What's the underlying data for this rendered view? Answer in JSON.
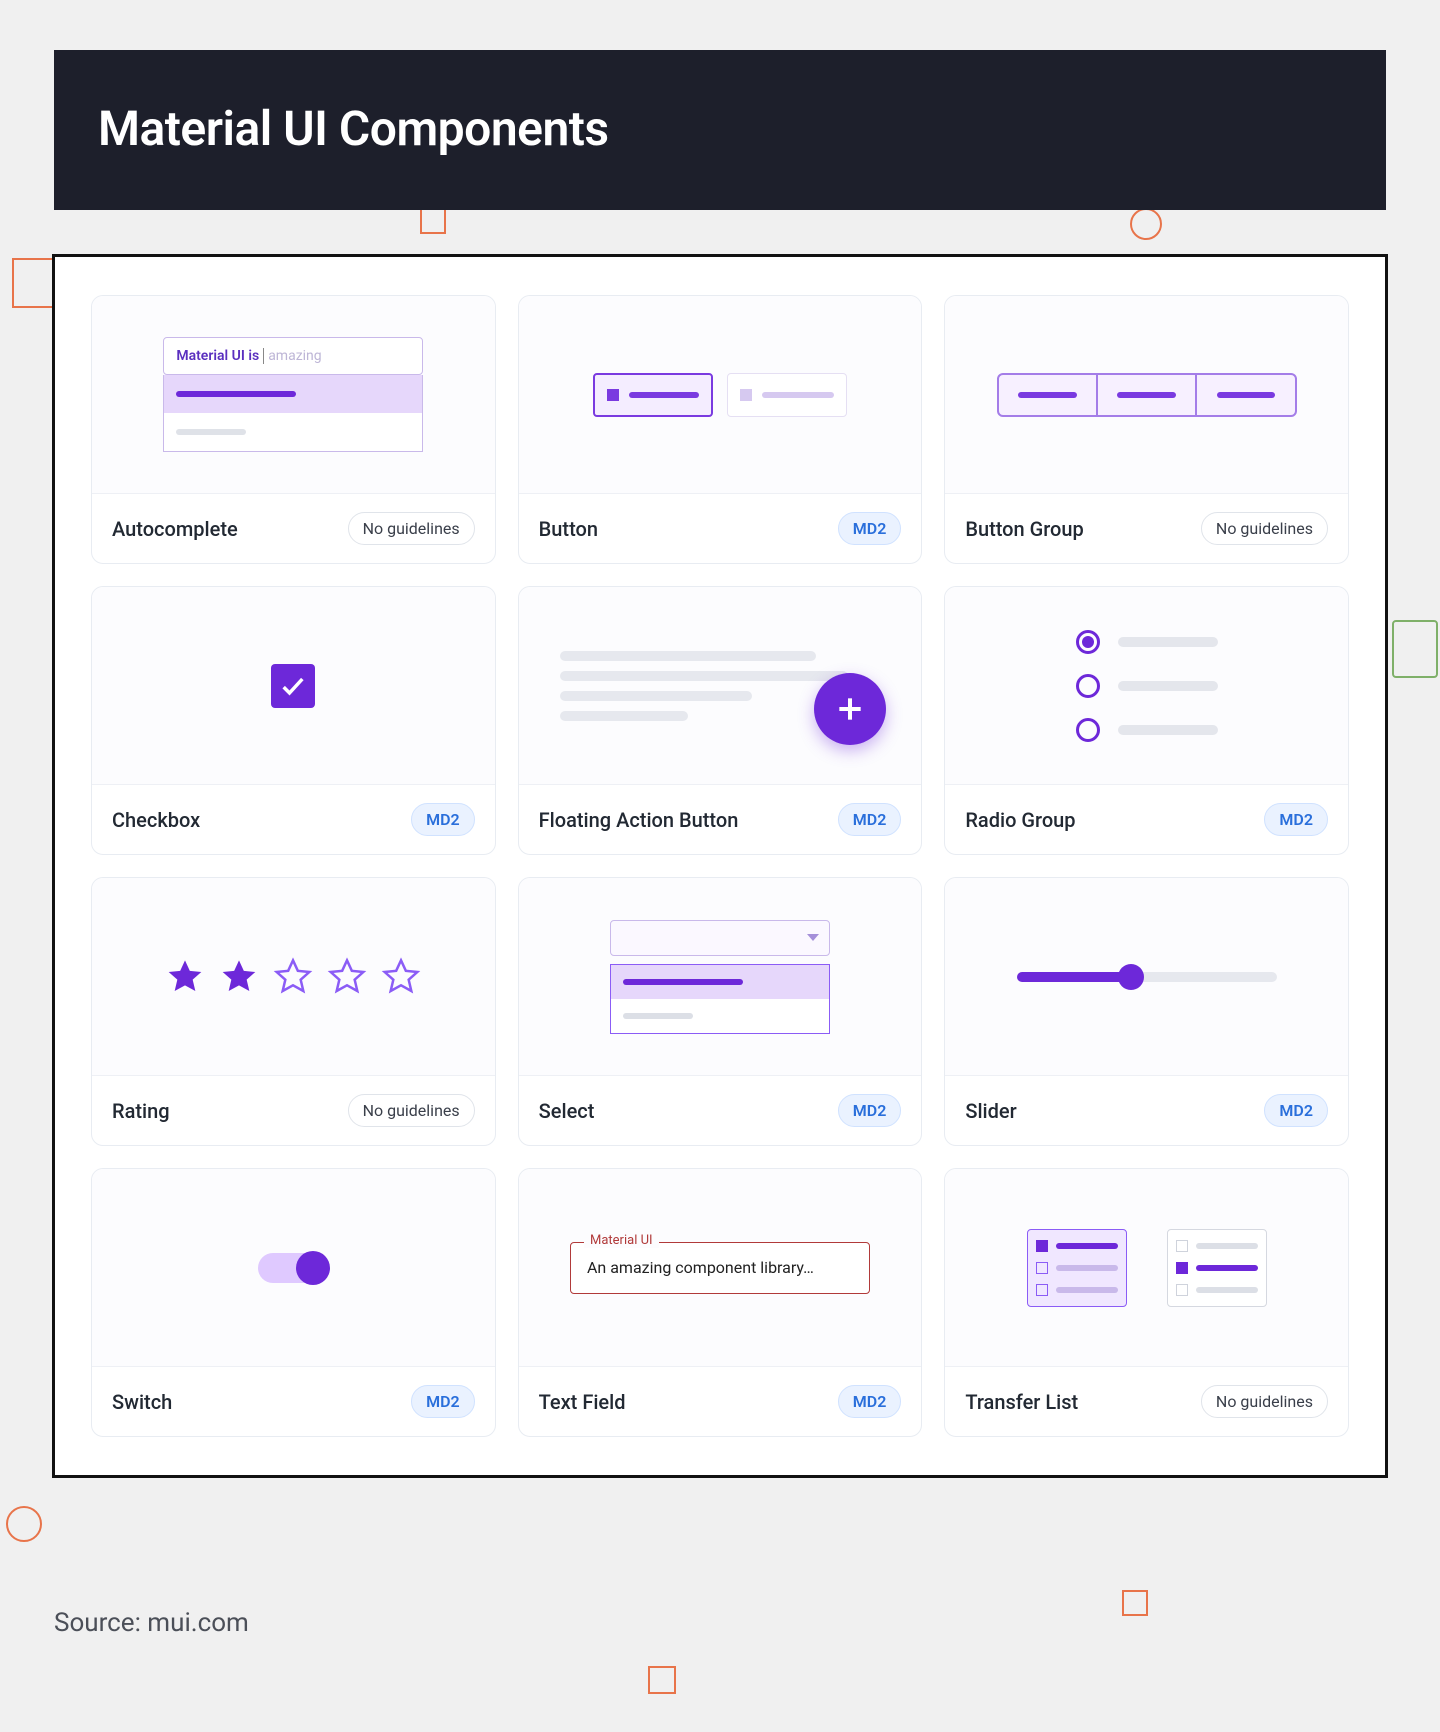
{
  "header": {
    "title": "Material UI Components"
  },
  "badges": {
    "md2": "MD2",
    "no_guidelines": "No guidelines"
  },
  "cards": {
    "autocomplete": {
      "title": "Autocomplete",
      "badge_key": "no_guidelines",
      "input_text": "Material UI is",
      "suggest_text": "amazing"
    },
    "button": {
      "title": "Button",
      "badge_key": "md2"
    },
    "button_group": {
      "title": "Button Group",
      "badge_key": "no_guidelines"
    },
    "checkbox": {
      "title": "Checkbox",
      "badge_key": "md2"
    },
    "fab": {
      "title": "Floating Action Button",
      "badge_key": "md2"
    },
    "radio": {
      "title": "Radio Group",
      "badge_key": "md2"
    },
    "rating": {
      "title": "Rating",
      "badge_key": "no_guidelines",
      "value": 2,
      "max": 5
    },
    "select": {
      "title": "Select",
      "badge_key": "md2"
    },
    "slider": {
      "title": "Slider",
      "badge_key": "md2"
    },
    "switch": {
      "title": "Switch",
      "badge_key": "md2"
    },
    "text_field": {
      "title": "Text Field",
      "badge_key": "md2",
      "label": "Material UI",
      "value": "An amazing component library…"
    },
    "transfer_list": {
      "title": "Transfer List",
      "badge_key": "no_guidelines"
    }
  },
  "source": "Source: mui.com"
}
